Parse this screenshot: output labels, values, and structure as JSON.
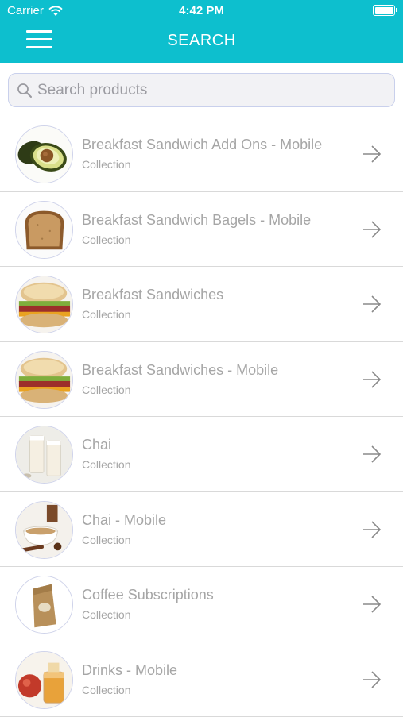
{
  "status_bar": {
    "carrier": "Carrier",
    "time": "4:42 PM"
  },
  "header": {
    "title": "SEARCH",
    "menu_icon": "hamburger-menu-icon"
  },
  "search": {
    "placeholder": "Search products",
    "value": ""
  },
  "colors": {
    "accent": "#0dbfce",
    "text_muted": "#a6a6a6",
    "search_bg": "#f2f2f5"
  },
  "items": [
    {
      "title": "Breakfast Sandwich Add Ons - Mobile",
      "subtitle": "Collection",
      "thumbnail": "avocado-image"
    },
    {
      "title": "Breakfast Sandwich Bagels - Mobile",
      "subtitle": "Collection",
      "thumbnail": "bread-slice-image"
    },
    {
      "title": "Breakfast Sandwiches",
      "subtitle": "Collection",
      "thumbnail": "breakfast-sandwich-image"
    },
    {
      "title": "Breakfast Sandwiches - Mobile",
      "subtitle": "Collection",
      "thumbnail": "breakfast-sandwich-image"
    },
    {
      "title": "Chai",
      "subtitle": "Collection",
      "thumbnail": "chai-glasses-image"
    },
    {
      "title": "Chai - Mobile",
      "subtitle": "Collection",
      "thumbnail": "chai-cup-image"
    },
    {
      "title": "Coffee Subscriptions",
      "subtitle": "Collection",
      "thumbnail": "coffee-bag-image"
    },
    {
      "title": "Drinks - Mobile",
      "subtitle": "Collection",
      "thumbnail": "drinks-image"
    }
  ]
}
